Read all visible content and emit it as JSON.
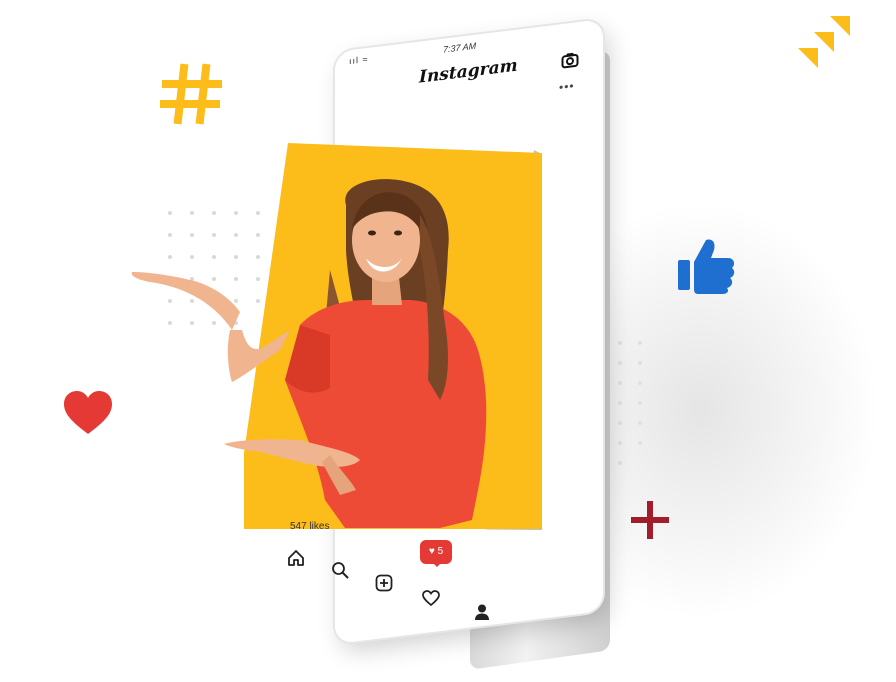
{
  "status_bar": {
    "time": "7:37 AM",
    "signal": "ııl ≈"
  },
  "app": {
    "title": "Instagram"
  },
  "post": {
    "more_menu": "•••",
    "likes_text": "547 likes"
  },
  "notification": {
    "label": "♥ 5"
  },
  "colors": {
    "accent_yellow": "#fcbc1a",
    "heart_red": "#e53935",
    "thumb_blue": "#1f6fd1",
    "plus_red": "#a11d2b",
    "shirt_red": "#ee4b36"
  },
  "icons": [
    "hashtag-icon",
    "chevron-stack-icon",
    "thumbs-up-icon",
    "heart-icon",
    "plus-icon",
    "camera-icon",
    "home-icon",
    "search-icon",
    "add-post-icon",
    "activity-heart-icon",
    "profile-icon"
  ]
}
